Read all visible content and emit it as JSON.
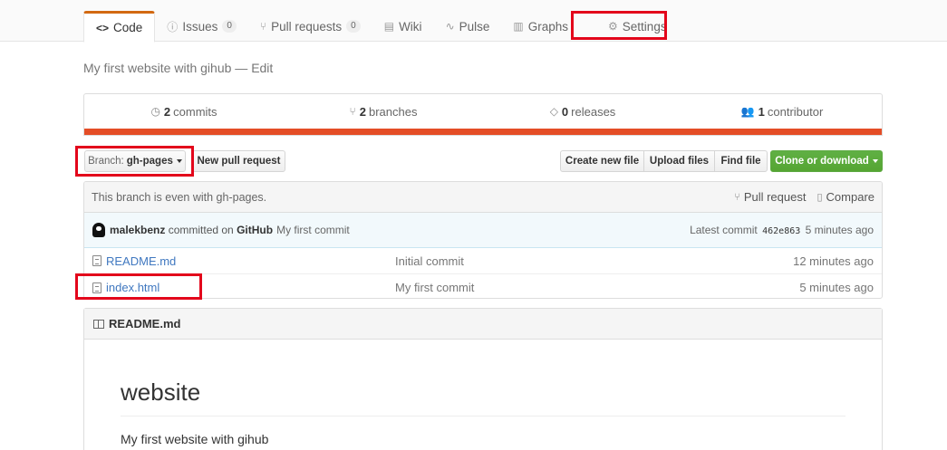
{
  "tabs": [
    {
      "label": "Code",
      "icon": "code-icon",
      "glyph": "<>"
    },
    {
      "label": "Issues",
      "icon": "issue-icon",
      "glyph": "ⓘ",
      "count": "0"
    },
    {
      "label": "Pull requests",
      "icon": "pull-request-icon",
      "glyph": "⑂",
      "count": "0"
    },
    {
      "label": "Wiki",
      "icon": "book-icon",
      "glyph": "▤"
    },
    {
      "label": "Pulse",
      "icon": "pulse-icon",
      "glyph": "∿"
    },
    {
      "label": "Graphs",
      "icon": "graph-icon",
      "glyph": "▥"
    },
    {
      "label": "Settings",
      "icon": "gear-icon",
      "glyph": "⚙"
    }
  ],
  "repo": {
    "description": "My first website with gihub",
    "edit_label": "Edit"
  },
  "summary": {
    "commits": {
      "count": "2",
      "label": "commits"
    },
    "branches": {
      "count": "2",
      "label": "branches"
    },
    "releases": {
      "count": "0",
      "label": "releases"
    },
    "contributors": {
      "count": "1",
      "label": "contributor"
    },
    "language_color": "#e44d26"
  },
  "toolbar": {
    "branch_prefix": "Branch:",
    "branch_name": "gh-pages",
    "new_pull_request": "New pull request",
    "create_new_file": "Create new file",
    "upload_files": "Upload files",
    "find_file": "Find file",
    "clone_or_download": "Clone or download"
  },
  "branch_status": {
    "text": "This branch is even with gh-pages.",
    "pull_request": "Pull request",
    "compare": "Compare"
  },
  "latest_commit": {
    "author": "malekbenz",
    "action": "committed on",
    "platform": "GitHub",
    "message": "My first commit",
    "latest_label": "Latest commit",
    "sha": "462e863",
    "age": "5 minutes ago"
  },
  "files": [
    {
      "name": "README.md",
      "message": "Initial commit",
      "age": "12 minutes ago"
    },
    {
      "name": "index.html",
      "message": "My first commit",
      "age": "5 minutes ago"
    }
  ],
  "readme": {
    "filename": "README.md",
    "heading": "website",
    "text": "My first website with gihub"
  },
  "colors": {
    "highlight": "#e3061b",
    "accent_tab": "#d26911",
    "link": "#4078c0",
    "clone_button": "#55a532"
  }
}
